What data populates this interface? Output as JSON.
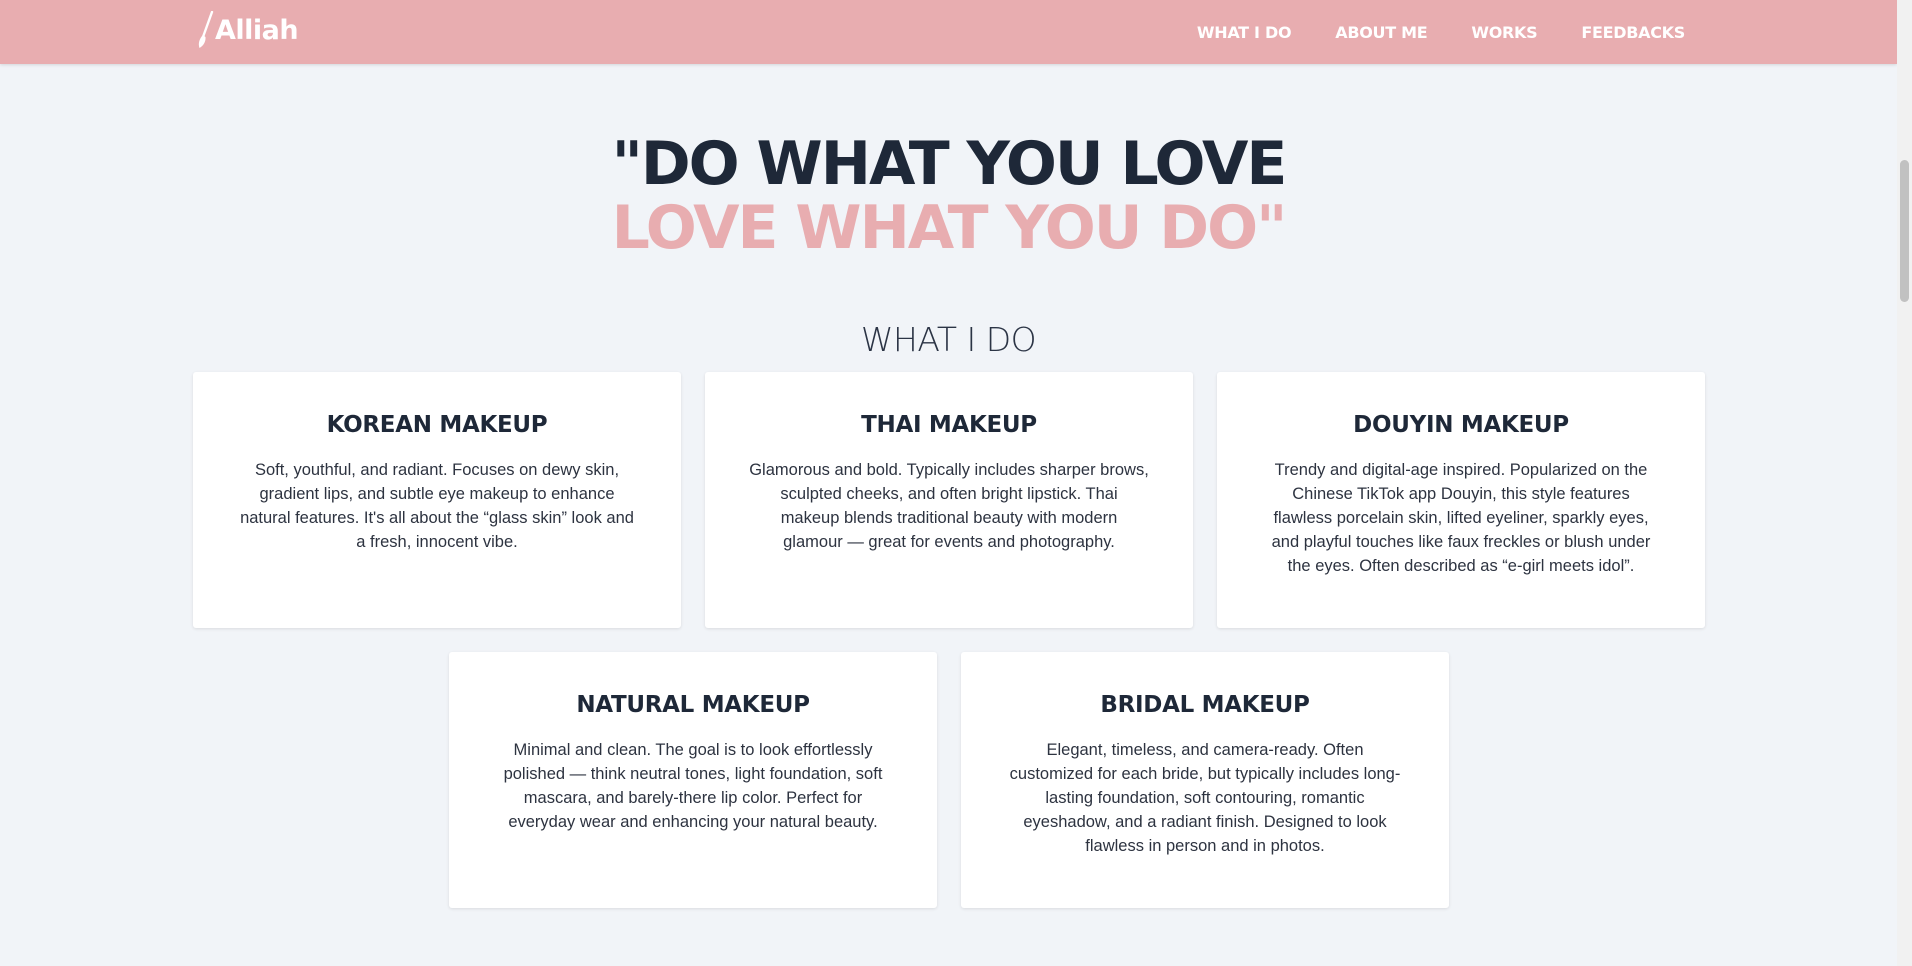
{
  "nav": {
    "logo_text": "Alliah",
    "links": [
      "WHAT I DO",
      "ABOUT ME",
      "WORKS",
      "FEEDBACKS"
    ]
  },
  "hero": {
    "line1": "\"DO WHAT YOU LOVE",
    "line2": "LOVE WHAT YOU DO\""
  },
  "section": {
    "title": "WHAT I DO"
  },
  "cards": [
    {
      "title": "KOREAN MAKEUP",
      "description": "Soft, youthful, and radiant. Focuses on dewy skin, gradient lips, and subtle eye makeup to enhance natural features. It's all about the “glass skin” look and a fresh, innocent vibe."
    },
    {
      "title": "THAI MAKEUP",
      "description": "Glamorous and bold. Typically includes sharper brows, sculpted cheeks, and often bright lipstick. Thai makeup blends traditional beauty with modern glamour — great for events and photography."
    },
    {
      "title": "DOUYIN MAKEUP",
      "description": "Trendy and digital-age inspired. Popularized on the Chinese TikTok app Douyin, this style features flawless porcelain skin, lifted eyeliner, sparkly eyes, and playful touches like faux freckles or blush under the eyes. Often described as “e-girl meets idol”."
    },
    {
      "title": "NATURAL MAKEUP",
      "description": "Minimal and clean. The goal is to look effortlessly polished — think neutral tones, light foundation, soft mascara, and barely-there lip color. Perfect for everyday wear and enhancing your natural beauty."
    },
    {
      "title": "BRIDAL MAKEUP",
      "description": "Elegant, timeless, and camera-ready. Often customized for each bride, but typically includes long-lasting foundation, soft contouring, romantic eyeshadow, and a radiant finish. Designed to look flawless in person and in photos."
    }
  ],
  "colors": {
    "accent": "#e8adb0",
    "dark": "#1e2838",
    "background": "#f1f4f8"
  }
}
